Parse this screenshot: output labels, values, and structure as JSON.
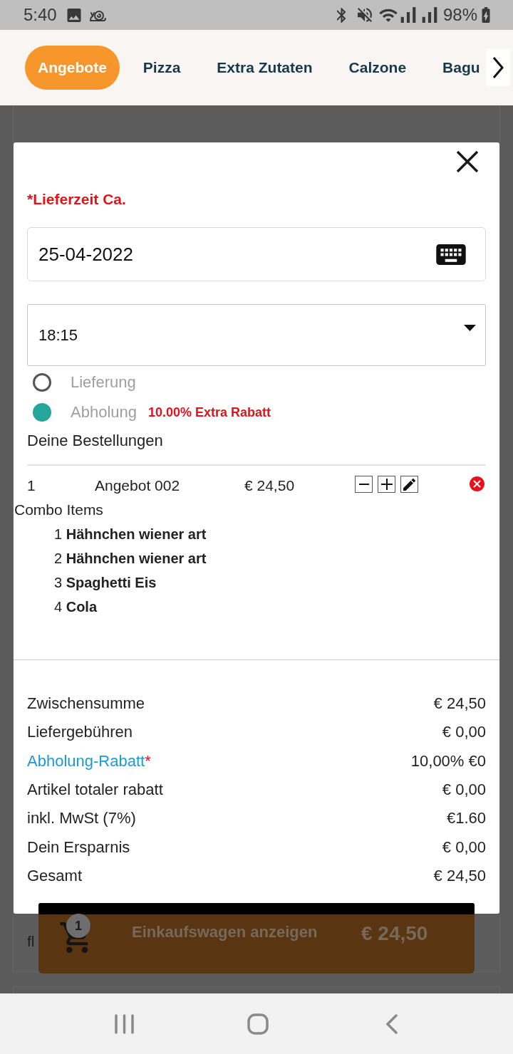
{
  "status_bar": {
    "time": "5:40",
    "battery": "98%"
  },
  "category_tabs": [
    {
      "label": "Angebote",
      "selected": true
    },
    {
      "label": "Pizza",
      "selected": false
    },
    {
      "label": "Extra Zutaten",
      "selected": false
    },
    {
      "label": "Calzone",
      "selected": false
    },
    {
      "label": "Bagu",
      "selected": false
    }
  ],
  "background_card": {
    "text": "fl"
  },
  "dialog": {
    "delivery_time_label": "*Lieferzeit Ca.",
    "date_field": {
      "value": "25-04-2022"
    },
    "time_select": {
      "value": "18:15"
    },
    "order_type_options": [
      {
        "label": "Lieferung",
        "selected": false
      },
      {
        "label": "Abholung",
        "selected": true,
        "note": "10.00% Extra Rabatt"
      }
    ],
    "orders_heading": "Deine Bestellungen",
    "order_lines": [
      {
        "quantity": "1",
        "name": "Angebot 002",
        "price": "€ 24,50",
        "combo_heading": "Combo Items",
        "combo_items": [
          {
            "number": "1",
            "name": "Hähnchen wiener art"
          },
          {
            "number": "2",
            "name": "Hähnchen wiener art"
          },
          {
            "number": "3",
            "name": "Spaghetti Eis"
          },
          {
            "number": "4",
            "name": "Cola"
          }
        ]
      }
    ],
    "summary": [
      {
        "kind": "amount",
        "label": "Zwischensumme",
        "value": "€ 24,50"
      },
      {
        "kind": "amount",
        "label": "Liefergebühren",
        "value": "€ 0,00"
      },
      {
        "kind": "discount",
        "label": "Abholung-Rabatt",
        "marker": "*",
        "value": "10,00% €0"
      },
      {
        "kind": "amount",
        "label": "Artikel totaler rabatt",
        "value": "€ 0,00"
      },
      {
        "kind": "amount",
        "label": "inkl. MwSt (7%)",
        "value": "€1.60"
      },
      {
        "kind": "amount",
        "label": "Dein Ersparnis",
        "value": "€ 0,00"
      },
      {
        "kind": "amount",
        "label": "Gesamt",
        "value": "€ 24,50"
      }
    ]
  },
  "cart_bar": {
    "badge": "1",
    "label": "Einkaufswagen anzeigen",
    "total": "€ 24,50"
  }
}
